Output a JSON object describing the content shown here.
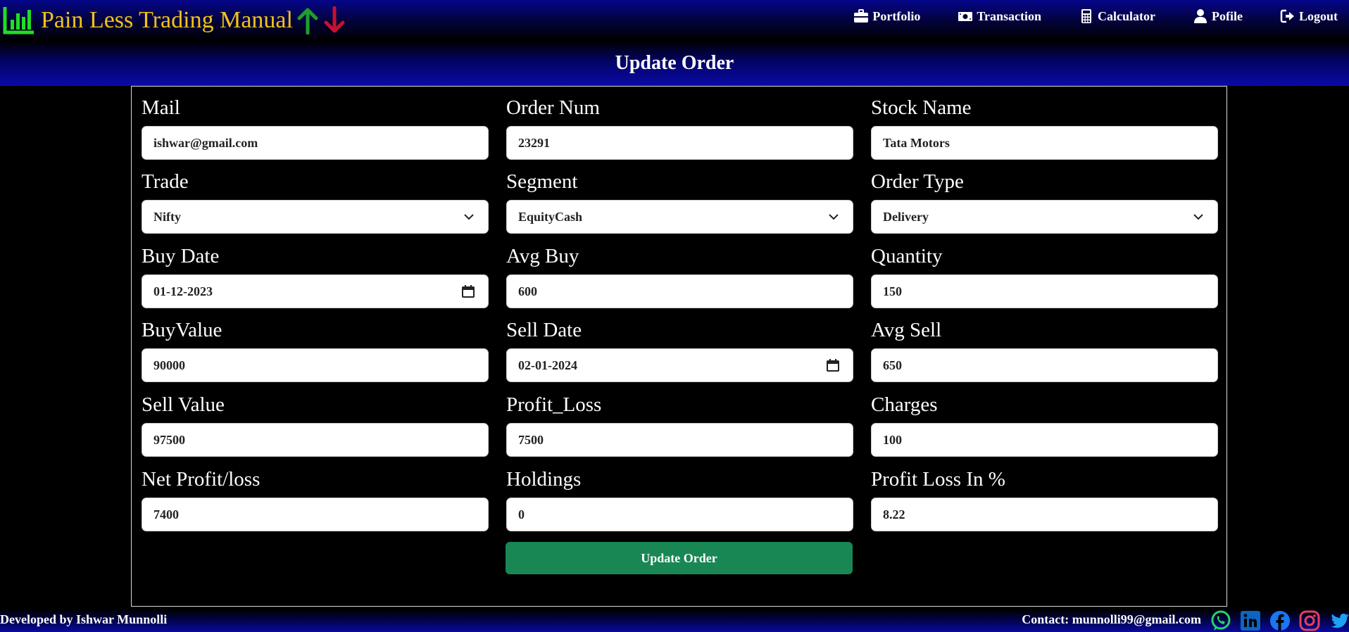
{
  "brand": {
    "title": "Pain Less Trading Manual",
    "title_color": "#f2c21b",
    "logo_icon": "chart-bar-icon",
    "up_arrow_color": "#1e9e2e",
    "down_arrow_color": "#c8102e"
  },
  "nav": [
    {
      "label": "Portfolio",
      "icon": "briefcase-icon"
    },
    {
      "label": "Transaction",
      "icon": "money-bill-icon"
    },
    {
      "label": "Calculator",
      "icon": "calculator-icon"
    },
    {
      "label": "Pofile",
      "icon": "user-icon"
    },
    {
      "label": "Logout",
      "icon": "sign-out-icon"
    }
  ],
  "page": {
    "title": "Update Order"
  },
  "form": {
    "mail": {
      "label": "Mail",
      "value": "ishwar@gmail.com"
    },
    "order_num": {
      "label": "Order Num",
      "value": "23291"
    },
    "stock_name": {
      "label": "Stock Name",
      "value": "Tata Motors"
    },
    "trade": {
      "label": "Trade",
      "value": "Nifty"
    },
    "segment": {
      "label": "Segment",
      "value": "EquityCash"
    },
    "order_type": {
      "label": "Order Type",
      "value": "Delivery"
    },
    "buy_date": {
      "label": "Buy Date",
      "value": "01-12-2023"
    },
    "avg_buy": {
      "label": "Avg Buy",
      "value": "600"
    },
    "quantity": {
      "label": "Quantity",
      "value": "150"
    },
    "buy_value": {
      "label": "BuyValue",
      "value": "90000"
    },
    "sell_date": {
      "label": "Sell Date",
      "value": "02-01-2024"
    },
    "avg_sell": {
      "label": "Avg Sell",
      "value": "650"
    },
    "sell_value": {
      "label": "Sell Value",
      "value": "97500"
    },
    "profit_loss": {
      "label": "Profit_Loss",
      "value": "7500"
    },
    "charges": {
      "label": "Charges",
      "value": "100"
    },
    "net_profit_loss": {
      "label": "Net Profit/loss",
      "value": "7400"
    },
    "holdings": {
      "label": "Holdings",
      "value": "0"
    },
    "profit_loss_pct": {
      "label": "Profit Loss In %",
      "value": "8.22"
    },
    "submit_label": "Update Order",
    "submit_color": "#198754"
  },
  "footer": {
    "developer": "Developed by Ishwar Munnolli",
    "contact": "Contact: munnolli99@gmail.com",
    "socials": [
      {
        "icon": "whatsapp-icon",
        "color": "#25d366"
      },
      {
        "icon": "linkedin-icon",
        "color": "#0a66c2"
      },
      {
        "icon": "facebook-icon",
        "color": "#1877f2"
      },
      {
        "icon": "instagram-icon",
        "color": "#e4405f"
      },
      {
        "icon": "twitter-icon",
        "color": "#1da1f2"
      }
    ]
  }
}
